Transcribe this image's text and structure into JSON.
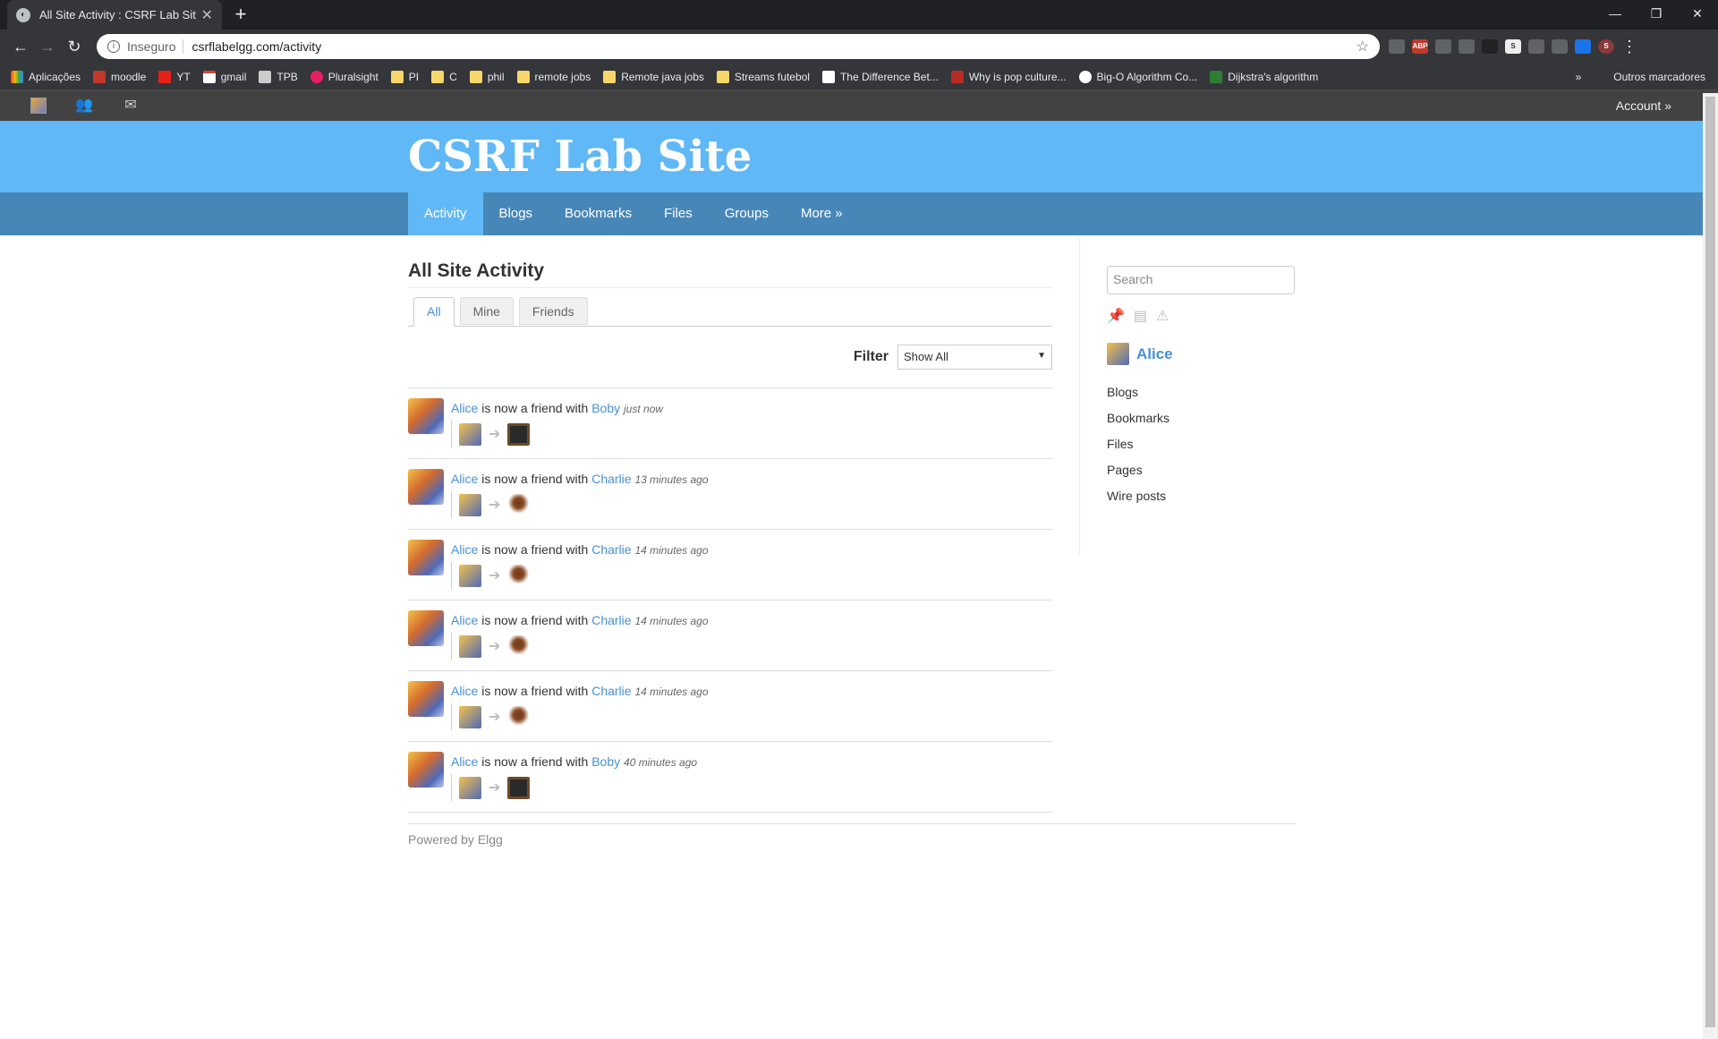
{
  "browser": {
    "tab_title": "All Site Activity : CSRF Lab Site",
    "insecure_label": "Inseguro",
    "url": "csrflabelgg.com/activity",
    "bookmarks": [
      "Aplicações",
      "moodle",
      "YT",
      "gmail",
      "TPB",
      "Pluralsight",
      "PI",
      "C",
      "phil",
      "remote jobs",
      "Remote java jobs",
      "Streams futebol",
      "The Difference Bet...",
      "Why is pop culture...",
      "Big-O Algorithm Co...",
      "Dijkstra's algorithm"
    ],
    "other_bookmarks": "Outros marcadores"
  },
  "topbar": {
    "account": "Account »"
  },
  "site": {
    "title": "CSRF Lab Site"
  },
  "menu": [
    "Activity",
    "Blogs",
    "Bookmarks",
    "Files",
    "Groups",
    "More »"
  ],
  "page": {
    "heading": "All Site Activity",
    "tabs": [
      "All",
      "Mine",
      "Friends"
    ],
    "filter_label": "Filter",
    "filter_value": "Show All"
  },
  "activity": [
    {
      "subject": "Alice",
      "verb": "is now a friend with",
      "object": "Boby",
      "time": "just now",
      "target": "boby"
    },
    {
      "subject": "Alice",
      "verb": "is now a friend with",
      "object": "Charlie",
      "time": "13 minutes ago",
      "target": "charlie"
    },
    {
      "subject": "Alice",
      "verb": "is now a friend with",
      "object": "Charlie",
      "time": "14 minutes ago",
      "target": "charlie"
    },
    {
      "subject": "Alice",
      "verb": "is now a friend with",
      "object": "Charlie",
      "time": "14 minutes ago",
      "target": "charlie"
    },
    {
      "subject": "Alice",
      "verb": "is now a friend with",
      "object": "Charlie",
      "time": "14 minutes ago",
      "target": "charlie"
    },
    {
      "subject": "Alice",
      "verb": "is now a friend with",
      "object": "Boby",
      "time": "40 minutes ago",
      "target": "boby"
    }
  ],
  "sidebar": {
    "search_placeholder": "Search",
    "owner": "Alice",
    "links": [
      "Blogs",
      "Bookmarks",
      "Files",
      "Pages",
      "Wire posts"
    ]
  },
  "footer": {
    "text": "Powered by Elgg"
  }
}
